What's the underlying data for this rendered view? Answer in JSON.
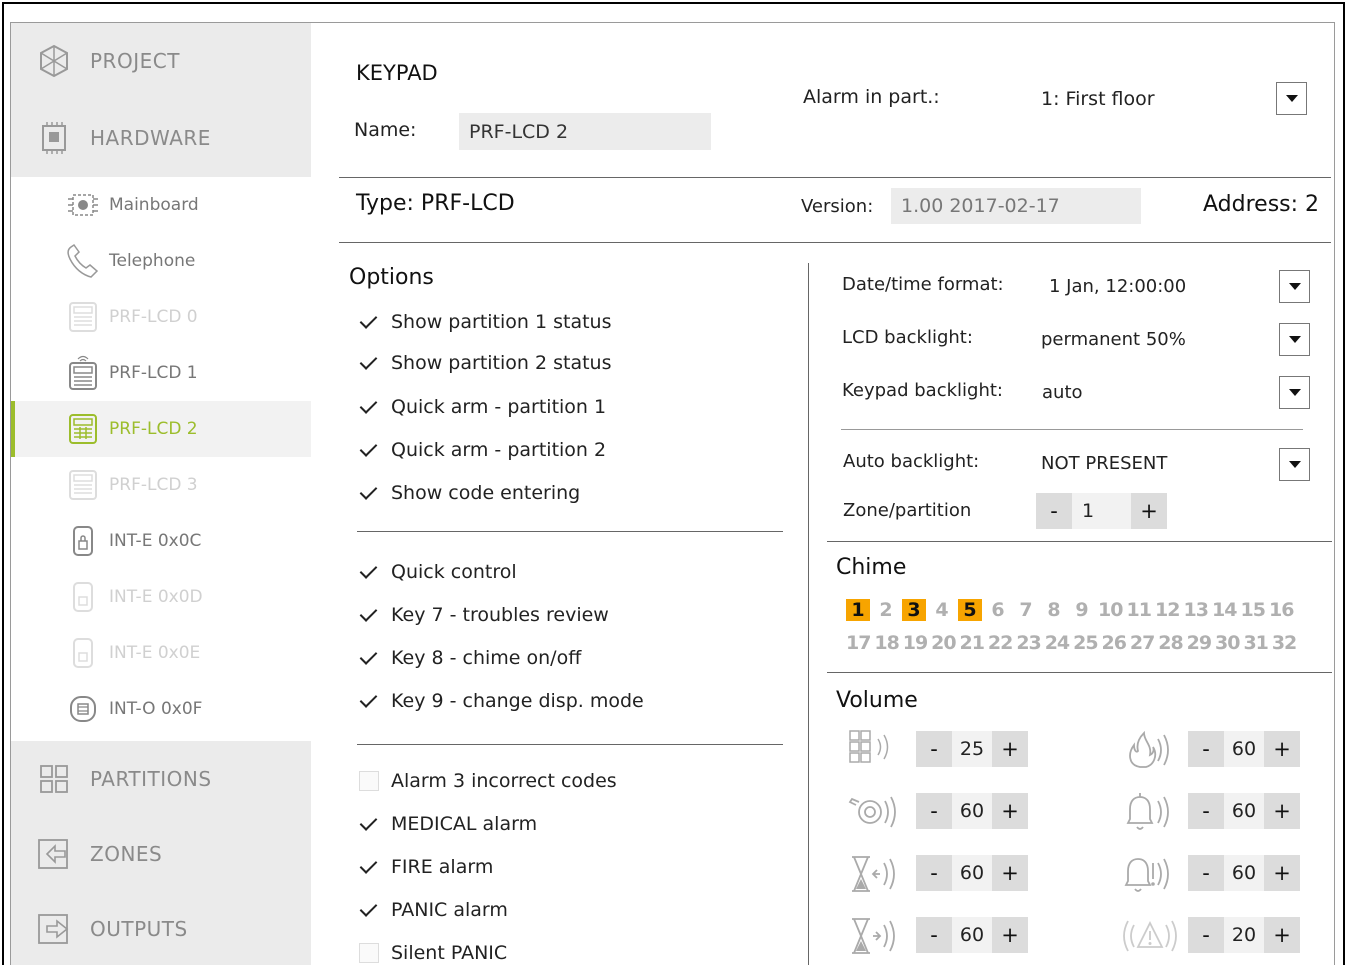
{
  "sidebar": {
    "project": "PROJECT",
    "hardware": "HARDWARE",
    "items": [
      {
        "label": "Mainboard"
      },
      {
        "label": "Telephone"
      },
      {
        "label": "PRF-LCD 0"
      },
      {
        "label": "PRF-LCD 1"
      },
      {
        "label": "PRF-LCD 2"
      },
      {
        "label": "PRF-LCD 3"
      },
      {
        "label": "INT-E 0x0C"
      },
      {
        "label": "INT-E 0x0D"
      },
      {
        "label": "INT-E 0x0E"
      },
      {
        "label": "INT-O 0x0F"
      }
    ],
    "partitions": "PARTITIONS",
    "zones": "ZONES",
    "outputs": "OUTPUTS",
    "accent_color": "#9cbd2c"
  },
  "header": {
    "title": "KEYPAD",
    "name_label": "Name:",
    "name_value": "PRF-LCD 2",
    "alarm_label": "Alarm in part.:",
    "alarm_value": "1: First floor",
    "type_text": "Type:  PRF-LCD",
    "version_label": "Version:",
    "version_value": "1.00 2017-02-17",
    "address_text": "Address:  2"
  },
  "options": {
    "title": "Options",
    "group1": [
      {
        "label": "Show partition 1 status",
        "checked": true
      },
      {
        "label": "Show partition 2 status",
        "checked": true
      },
      {
        "label": "Quick arm - partition 1",
        "checked": true
      },
      {
        "label": "Quick arm - partition 2",
        "checked": true
      },
      {
        "label": "Show code entering",
        "checked": true
      }
    ],
    "group2": [
      {
        "label": "Quick control",
        "checked": true
      },
      {
        "label": "Key 7 - troubles review",
        "checked": true
      },
      {
        "label": "Key 8 - chime on/off",
        "checked": true
      },
      {
        "label": "Key 9 - change disp. mode",
        "checked": true
      }
    ],
    "group3": [
      {
        "label": "Alarm 3 incorrect codes",
        "checked": false
      },
      {
        "label": "MEDICAL alarm",
        "checked": true
      },
      {
        "label": "FIRE alarm",
        "checked": true
      },
      {
        "label": "PANIC alarm",
        "checked": true
      },
      {
        "label": "Silent PANIC",
        "checked": false
      }
    ]
  },
  "settings": {
    "date_label": "Date/time format:",
    "date_value": "1 Jan, 12:00:00",
    "lcd_label": "LCD backlight:",
    "lcd_value": "permanent 50%",
    "keypad_label": "Keypad backlight:",
    "keypad_value": "auto",
    "auto_label": "Auto backlight:",
    "auto_value": "NOT PRESENT",
    "zone_label": "Zone/partition",
    "zone_value": "1"
  },
  "chime": {
    "title": "Chime",
    "row1": [
      "1",
      "2",
      "3",
      "4",
      "5",
      "6",
      "7",
      "8",
      "9",
      "10",
      "11",
      "12",
      "13",
      "14",
      "15",
      "16"
    ],
    "row2": [
      "17",
      "18",
      "19",
      "20",
      "21",
      "22",
      "23",
      "24",
      "25",
      "26",
      "27",
      "28",
      "29",
      "30",
      "31",
      "32"
    ],
    "selected": [
      "1",
      "3",
      "5"
    ],
    "selected_color": "#f7a400"
  },
  "volume": {
    "title": "Volume",
    "minus": "-",
    "plus": "+",
    "left": [
      {
        "icon": "keypad-sound-icon",
        "value": "25"
      },
      {
        "icon": "siren-sound-icon",
        "value": "60"
      },
      {
        "icon": "entry-delay-sound-icon",
        "value": "60"
      },
      {
        "icon": "exit-delay-sound-icon",
        "value": "60"
      }
    ],
    "right": [
      {
        "icon": "fire-alarm-sound-icon",
        "value": "60"
      },
      {
        "icon": "bell-sound-icon",
        "value": "60"
      },
      {
        "icon": "bell-warning-sound-icon",
        "value": "60"
      },
      {
        "icon": "warning-sound-icon",
        "value": "20"
      }
    ]
  }
}
